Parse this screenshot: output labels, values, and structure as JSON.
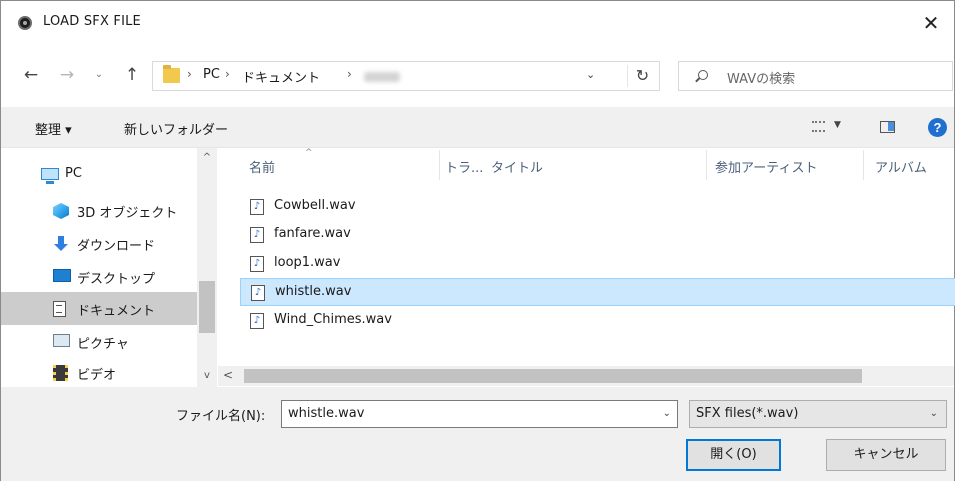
{
  "window": {
    "title": "LOAD SFX FILE",
    "close_glyph": "✕"
  },
  "nav": {
    "back_glyph": "←",
    "forward_glyph": "→",
    "recent_glyph": "⌄",
    "up_glyph": "↑",
    "breadcrumb": [
      "PC",
      "ドキュメント"
    ],
    "breadcrumb_sep": "›",
    "refresh_glyph": "↻",
    "dropdown_glyph": "⌄"
  },
  "search": {
    "placeholder": "WAVの検索"
  },
  "commands": {
    "organize": "整理 ▾",
    "new_folder": "新しいフォルダー",
    "view_dropdown": "▼",
    "help": "?"
  },
  "sidebar": {
    "items": [
      {
        "label": "PC",
        "icon": "pc-icon"
      },
      {
        "label": "3D オブジェクト",
        "icon": "3d-objects-icon"
      },
      {
        "label": "ダウンロード",
        "icon": "download-icon"
      },
      {
        "label": "デスクトップ",
        "icon": "desktop-icon"
      },
      {
        "label": "ドキュメント",
        "icon": "documents-icon",
        "selected": true
      },
      {
        "label": "ピクチャ",
        "icon": "pictures-icon"
      },
      {
        "label": "ビデオ",
        "icon": "videos-icon"
      }
    ],
    "scroll_up": "^",
    "scroll_down": "v"
  },
  "filelist": {
    "columns": [
      "名前",
      "トラ...",
      "タイトル",
      "参加アーティスト",
      "アルバム"
    ],
    "sort_arrow": "^",
    "file_glyph": "♪",
    "files": [
      {
        "name": "Cowbell.wav"
      },
      {
        "name": "fanfare.wav"
      },
      {
        "name": "loop1.wav"
      },
      {
        "name": "whistle.wav",
        "selected": true
      },
      {
        "name": "Wind_Chimes.wav"
      }
    ],
    "hscroll_left": "<"
  },
  "footer": {
    "filename_label": "ファイル名(N):",
    "filename_value": "whistle.wav",
    "filetype_value": "SFX files(*.wav)",
    "open_button": "開く(O)",
    "cancel_button": "キャンセル",
    "dropdown_glyph": "⌄"
  },
  "colors": {
    "accent": "#0078d7",
    "selection_bg": "#cce8ff",
    "selection_border": "#99d1ff",
    "help_icon": "#1f6fd1"
  }
}
